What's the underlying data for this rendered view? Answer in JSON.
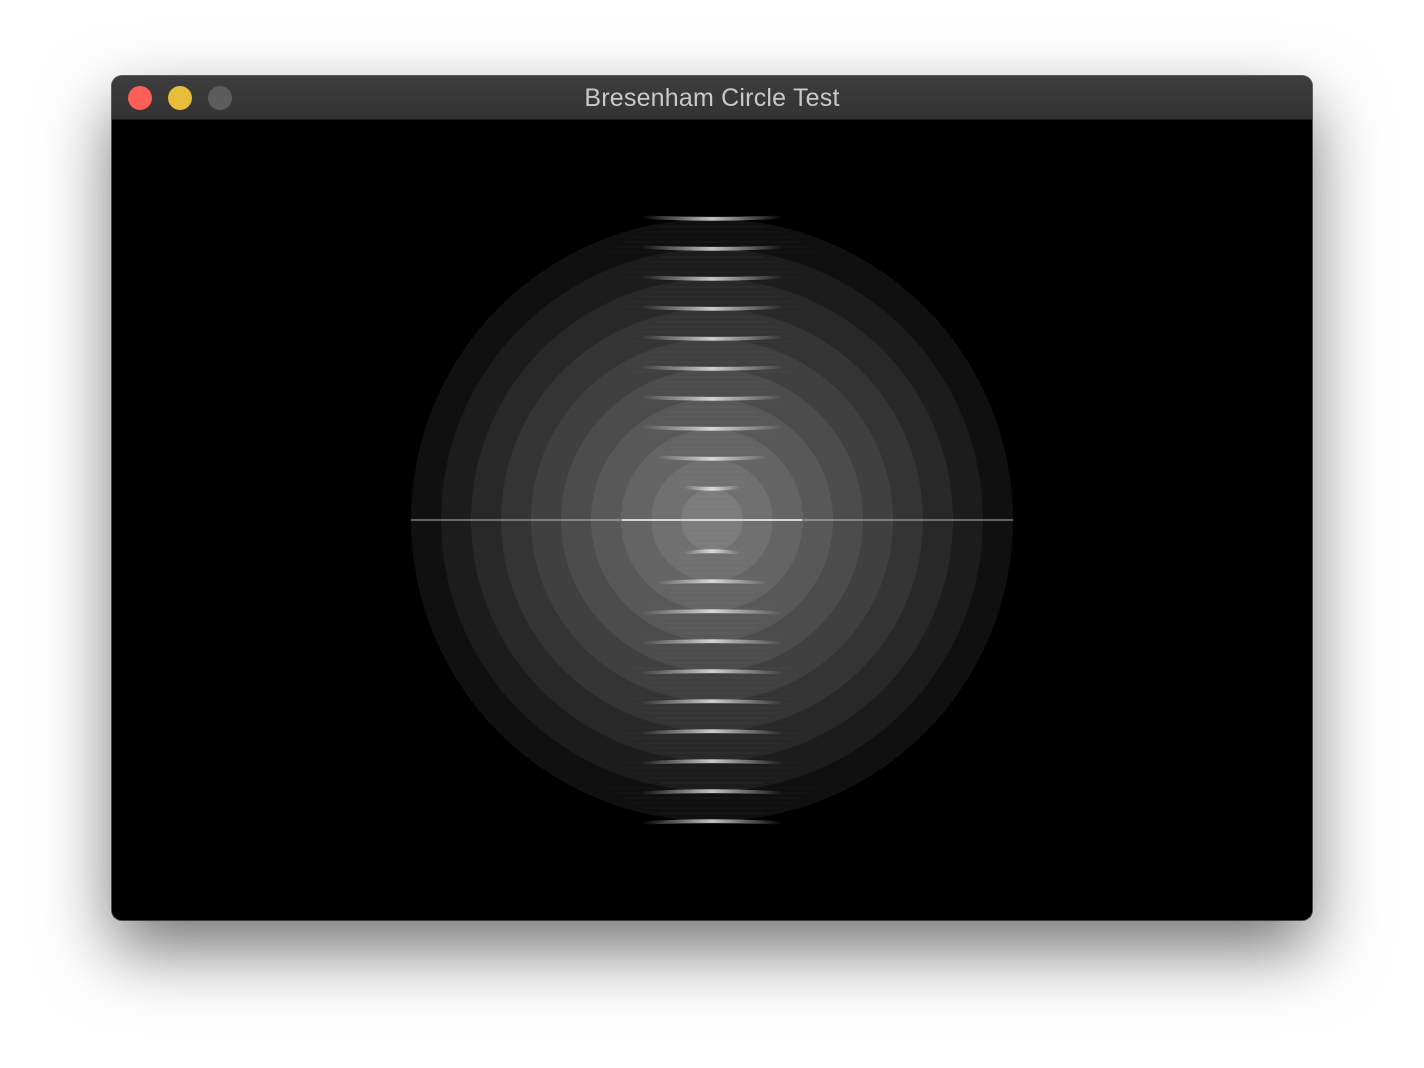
{
  "window": {
    "title": "Bresenham Circle Test",
    "background": "#000000"
  },
  "traffic_lights": [
    {
      "name": "close",
      "color": "#fe5f57"
    },
    {
      "name": "minimize",
      "color": "#e7bd3a"
    },
    {
      "name": "zoom",
      "color": "#5c5c5c"
    }
  ],
  "scene": {
    "description_type": "concentric-circles",
    "ring_count": 10,
    "ring_gray_levels": [
      "#101010",
      "#1c1c1c",
      "#282828",
      "#343434",
      "#404040",
      "#4c4c4c",
      "#585858",
      "#646464",
      "#707070",
      "#7c7c7c"
    ],
    "center_line_color": "#d8d8d8"
  }
}
